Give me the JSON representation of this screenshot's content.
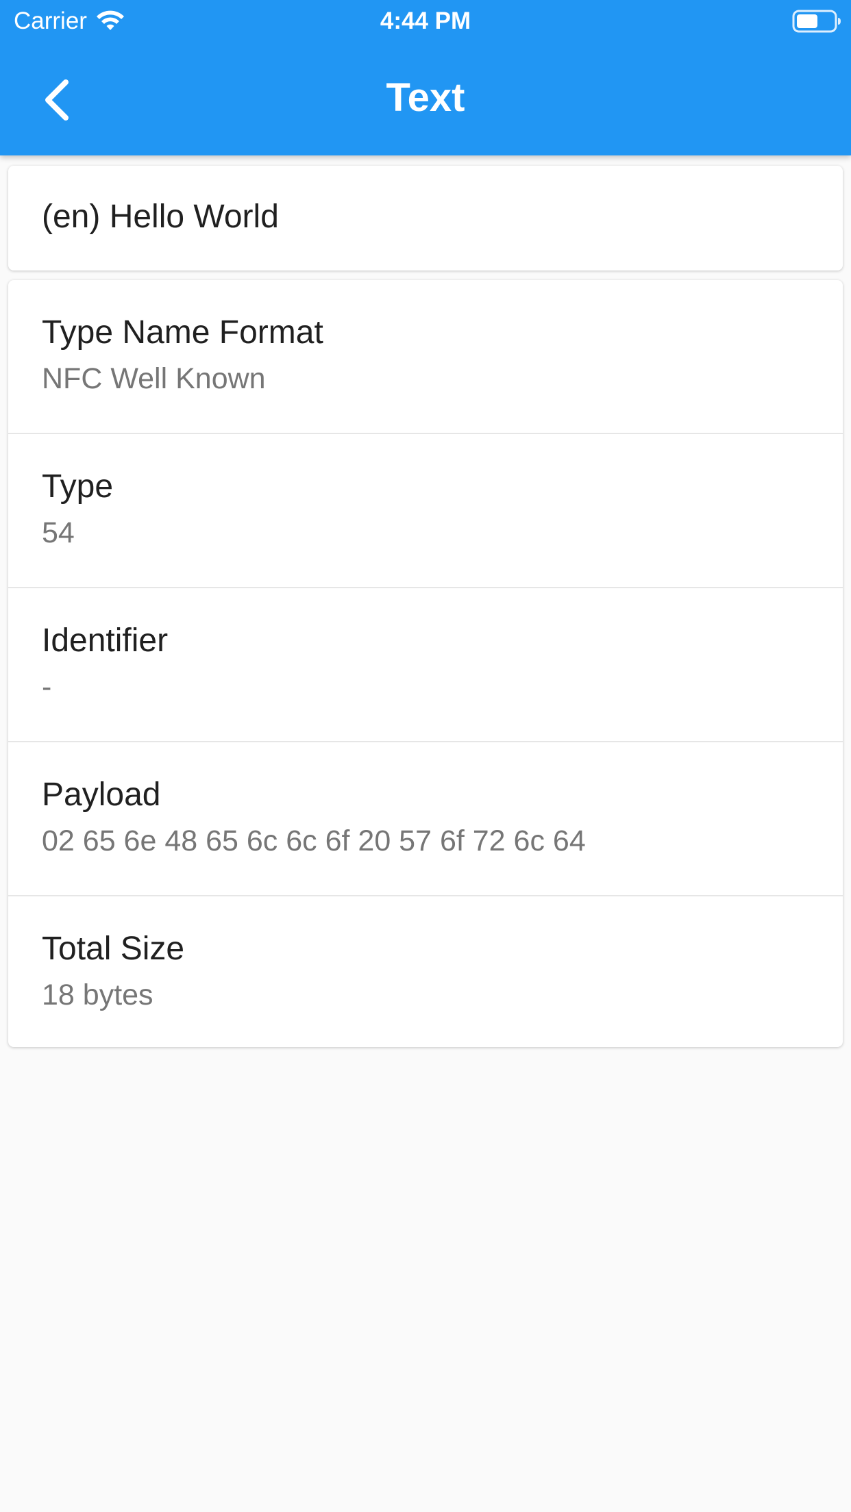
{
  "status_bar": {
    "carrier": "Carrier",
    "time": "4:44 PM",
    "wifi_icon": "wifi-icon",
    "battery_icon": "battery-icon"
  },
  "nav": {
    "title": "Text",
    "back_icon": "chevron-left-icon"
  },
  "record": {
    "text": "(en) Hello World"
  },
  "details": [
    {
      "label": "Type Name Format",
      "value": "NFC Well Known"
    },
    {
      "label": "Type",
      "value": "54"
    },
    {
      "label": "Identifier",
      "value": "-"
    },
    {
      "label": "Payload",
      "value": "02 65 6e 48 65 6c 6c 6f 20 57 6f 72 6c 64"
    },
    {
      "label": "Total Size",
      "value": "18 bytes"
    }
  ],
  "colors": {
    "app_bar": "#2196f3",
    "background": "#fafafa",
    "card": "#ffffff",
    "primary_text": "#202020",
    "secondary_text": "#767676"
  }
}
